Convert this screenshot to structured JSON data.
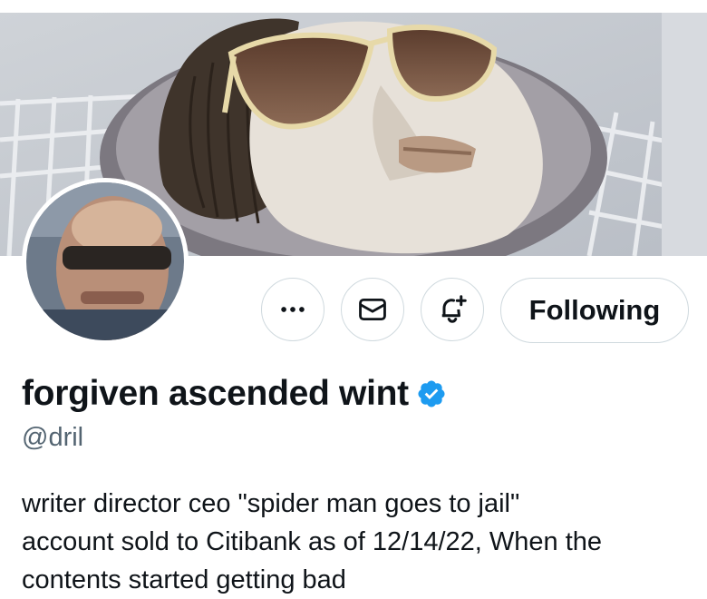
{
  "profile": {
    "display_name": "forgiven ascended wint",
    "handle": "@dril",
    "verified": true,
    "bio_lines": [
      "writer director ceo \"spider man goes to jail\"",
      "account sold to Citibank as of 12/14/22, When the",
      "contents started getting bad"
    ]
  },
  "actions": {
    "more_icon": "more-horizontal-icon",
    "message_icon": "envelope-icon",
    "notify_icon": "bell-plus-icon",
    "following_label": "Following"
  },
  "colors": {
    "verified_blue": "#1d9bf0",
    "text_primary": "#0f1419",
    "text_secondary": "#536471",
    "border": "#cfd9de"
  }
}
